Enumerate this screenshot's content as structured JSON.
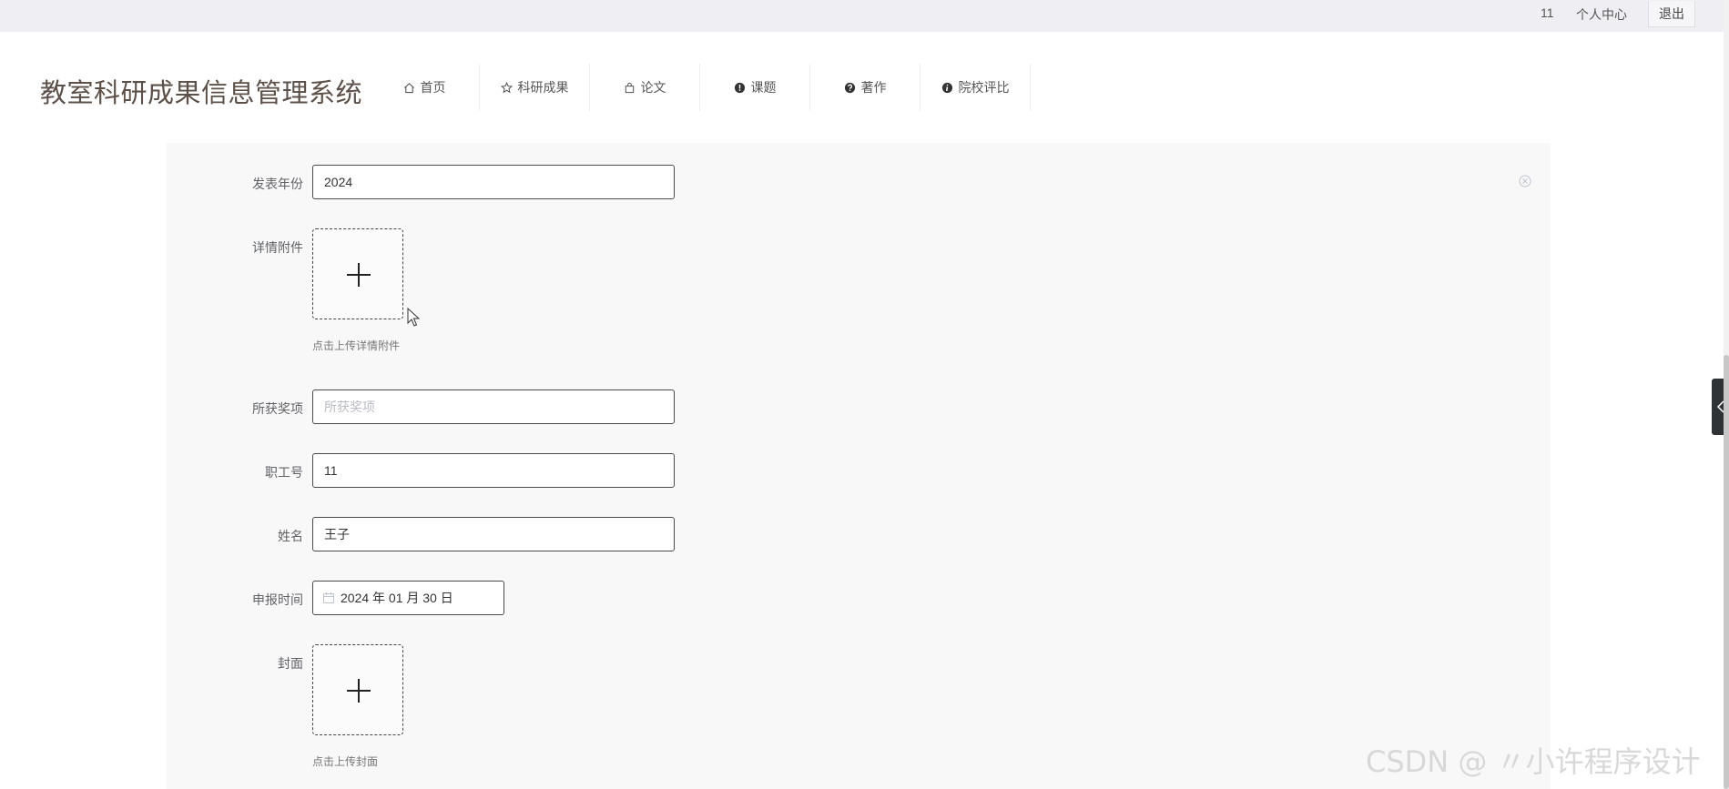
{
  "topbar": {
    "user_id": "11",
    "personal_center": "个人中心",
    "logout": "退出"
  },
  "site": {
    "title": "教室科研成果信息管理系统"
  },
  "nav": {
    "items": [
      {
        "label": "首页",
        "icon": "home-icon"
      },
      {
        "label": "科研成果",
        "icon": "star-icon"
      },
      {
        "label": "论文",
        "icon": "bag-icon"
      },
      {
        "label": "课题",
        "icon": "exclamation-circle-icon"
      },
      {
        "label": "著作",
        "icon": "question-circle-icon"
      },
      {
        "label": "院校评比",
        "icon": "info-circle-icon"
      }
    ]
  },
  "form": {
    "publish_year": {
      "label": "发表年份",
      "value": "2024"
    },
    "attachment": {
      "label": "详情附件",
      "tip": "点击上传详情附件"
    },
    "award": {
      "label": "所获奖项",
      "value": "",
      "placeholder": "所获奖项"
    },
    "staff_no": {
      "label": "职工号",
      "value": "11"
    },
    "name": {
      "label": "姓名",
      "value": "王子"
    },
    "apply_time": {
      "label": "申报时间",
      "value": "2024 年 01 月 30 日"
    },
    "cover": {
      "label": "封面",
      "tip": "点击上传封面"
    }
  },
  "watermark": "CSDN @ 〃小许程序设计",
  "colors": {
    "title": "#5d5048",
    "panel_bg": "#f8f8f9",
    "topbar_bg": "#efeff3"
  }
}
